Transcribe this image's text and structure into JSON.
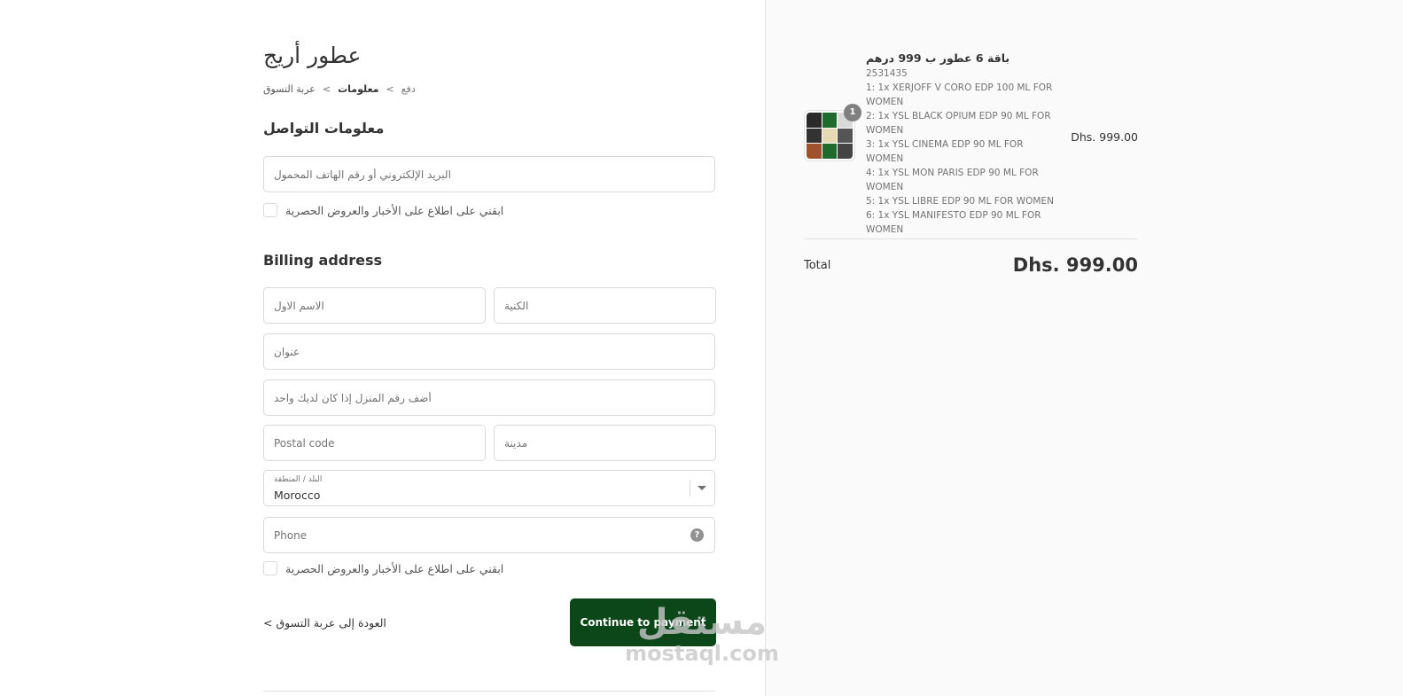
{
  "store": {
    "name": "عطور أريج"
  },
  "breadcrumb": {
    "cart": "عربة التسوق",
    "information": "معلومات",
    "payment": "دفع",
    "separator": "<"
  },
  "contact": {
    "title": "معلومات التواصل",
    "email_placeholder": "البريد الإلكتروني أو رقم الهاتف المحمول",
    "newsletter_label": "ابقني على اطلاع على الأخبار والعروض الحصرية"
  },
  "billing": {
    "title": "Billing address",
    "first_name_placeholder": "الاسم الاول",
    "last_name_placeholder": "الكنية",
    "address_placeholder": "عنوان",
    "apartment_placeholder": "أضف رقم المنزل إذا كان لديك واحد",
    "postal_placeholder": "Postal code",
    "city_placeholder": "مدينة",
    "country_label": "البلد / المنطقة",
    "country_value": "Morocco",
    "phone_placeholder": "Phone",
    "phone_help_icon": "question-mark",
    "sms_label": "ابقني على اطلاع على الأخبار والعروض الحصرية"
  },
  "actions": {
    "return_label": "العودة إلى عربة التسوق",
    "continue_label": "Continue to payment",
    "accent_color": "#0b4719"
  },
  "order_summary": {
    "product": {
      "name": "باقة 6 عطور ب 999 درهم",
      "sku": "2531435",
      "lines": [
        "1: 1x XERJOFF V CORO EDP 100 ML FOR WOMEN",
        "2: 1x YSL BLACK OPIUM EDP 90 ML FOR WOMEN",
        "3: 1x YSL CINEMA EDP 90 ML FOR WOMEN",
        "4: 1x YSL MON PARIS EDP 90 ML FOR WOMEN",
        "5: 1x YSL LIBRE EDP 90 ML FOR WOMEN",
        "6: 1x YSL MANIFESTO EDP 90 ML FOR WOMEN"
      ],
      "quantity": "1",
      "price": "Dhs. 999.00"
    },
    "total_label": "Total",
    "total_value": "Dhs. 999.00"
  },
  "watermark": {
    "arabic": "مستقل",
    "latin": "mostaql.com"
  }
}
